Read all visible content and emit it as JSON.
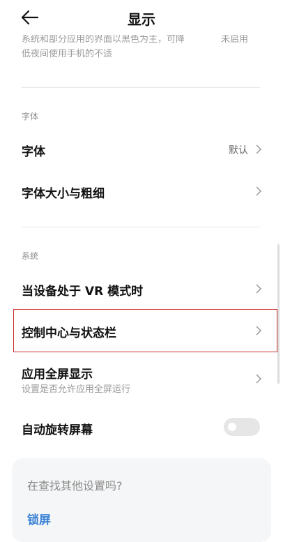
{
  "header": {
    "title": "显示",
    "back_icon": "arrow-left-icon"
  },
  "dark_mode_item": {
    "description_line1": "系统和部分应用的界面以黑色为主，可降",
    "description_line2": "低夜间使用手机的不适",
    "value": "未启用"
  },
  "font_section": {
    "label": "字体",
    "items": [
      {
        "title": "字体",
        "value": "默认"
      },
      {
        "title": "字体大小与粗细"
      }
    ]
  },
  "system_section": {
    "label": "系统",
    "items": [
      {
        "title": "当设备处于 VR 模式时"
      },
      {
        "title": "控制中心与状态栏"
      },
      {
        "title": "应用全屏显示",
        "subtitle": "设置是否允许应用全屏运行"
      },
      {
        "title": "自动旋转屏幕",
        "toggle_on": false
      }
    ]
  },
  "suggest_card": {
    "question": "在查找其他设置吗?",
    "link": "锁屏"
  },
  "colors": {
    "highlight": "#c8312c",
    "link": "#3b83d6"
  }
}
